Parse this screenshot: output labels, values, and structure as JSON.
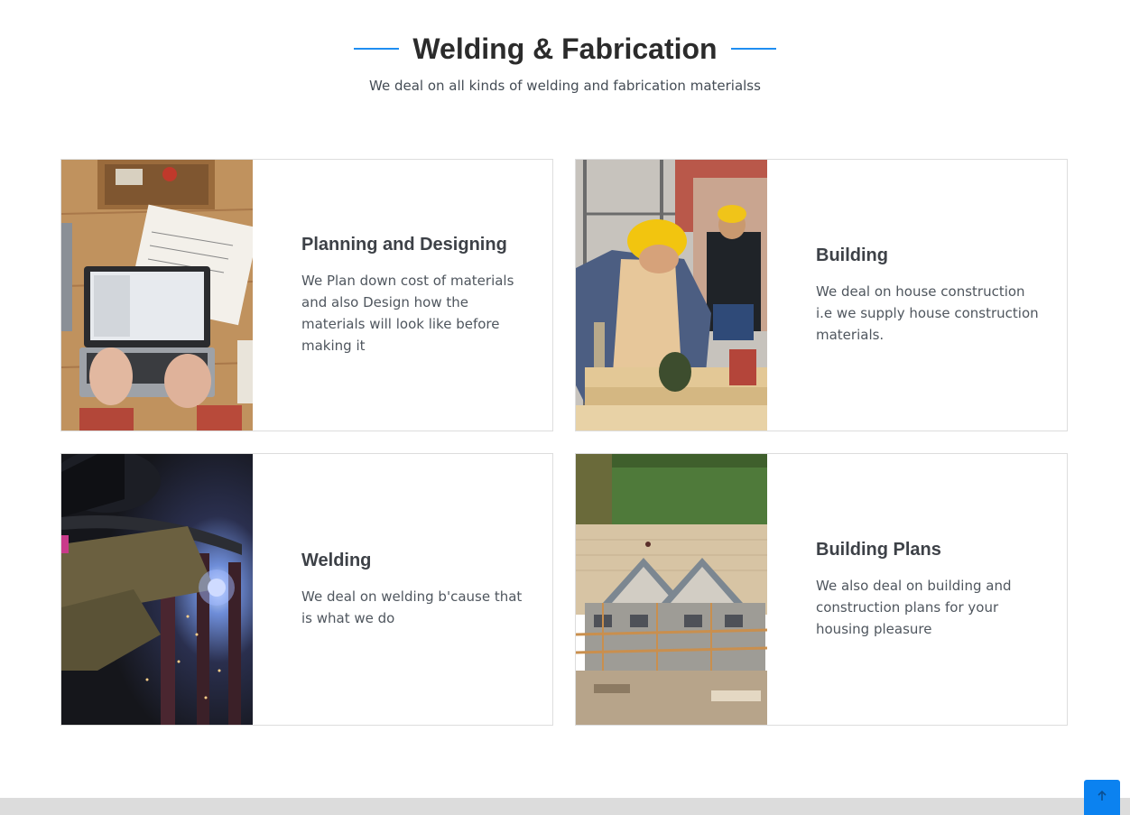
{
  "header": {
    "title": "Welding & Fabrication",
    "subtitle": "We deal on all kinds of welding and fabrication materialss",
    "accent_color": "#1f8ef1"
  },
  "cards": [
    {
      "title": "Planning and Designing",
      "text": "We Plan down cost of materials and also Design how the materials will look like before making it",
      "image": "laptop-workbench-photo"
    },
    {
      "title": "Building",
      "text": "We deal on house construction i.e we supply house construction materials.",
      "image": "construction-workers-photo"
    },
    {
      "title": "Welding",
      "text": "We deal on welding b'cause that is what we do",
      "image": "welder-sparks-photo"
    },
    {
      "title": "Building Plans",
      "text": "We also deal on building and construction plans for your housing pleasure",
      "image": "house-under-construction-photo"
    }
  ],
  "back_to_top": {
    "icon": "arrow-up-icon",
    "color": "#0b82f0"
  }
}
